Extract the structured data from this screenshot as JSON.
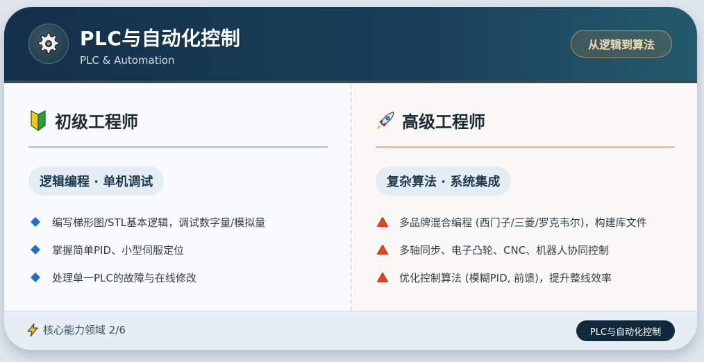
{
  "header": {
    "title": "PLC与自动化控制",
    "subtitle": "PLC & Automation",
    "badge": "从逻辑到算法",
    "icon": "gear-icon"
  },
  "junior": {
    "heading": "初级工程师",
    "icon": "beginner-badge-icon",
    "tag": "逻辑编程 · 单机调试",
    "items": [
      "编写梯形图/STL基本逻辑，调试数字量/模拟量",
      "掌握简单PID、小型伺服定位",
      "处理单一PLC的故障与在线修改"
    ],
    "bullet_icon": "blue-diamond-icon"
  },
  "senior": {
    "heading": "高级工程师",
    "icon": "rocket-icon",
    "tag": "复杂算法 · 系统集成",
    "items": [
      "多品牌混合编程 (西门子/三菱/罗克韦尔)，构建库文件",
      "多轴同步、电子凸轮、CNC、机器人协同控制",
      "优化控制算法 (模糊PID, 前馈)，提升整线效率"
    ],
    "bullet_icon": "red-triangle-icon"
  },
  "footer": {
    "label": "核心能力领域 2/6",
    "icon": "lightning-icon",
    "pill": "PLC与自动化控制"
  },
  "colors": {
    "header_bg": "#133049",
    "badge_text": "#f3ddb0",
    "junior_accent": "#a9bde7",
    "senior_accent": "#e8b38e",
    "diamond": "#1e6fd0",
    "triangle": "#e4451f",
    "footer_pill": "#102a3d"
  }
}
